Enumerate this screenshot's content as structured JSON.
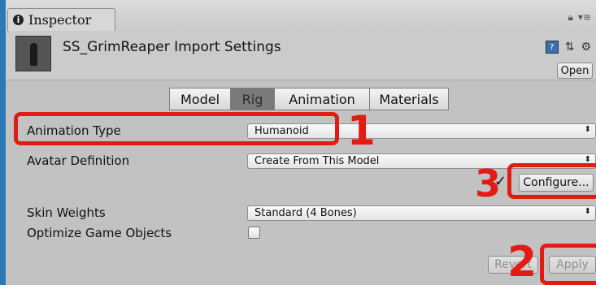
{
  "tab": {
    "title": "Inspector"
  },
  "header": {
    "title": "SS_GrimReaper Import Settings",
    "open_label": "Open"
  },
  "model_tabs": [
    {
      "label": "Model",
      "active": false
    },
    {
      "label": "Rig",
      "active": true
    },
    {
      "label": "Animation",
      "active": false
    },
    {
      "label": "Materials",
      "active": false
    }
  ],
  "fields": {
    "animation_type": {
      "label": "Animation Type",
      "value": "Humanoid"
    },
    "avatar_definition": {
      "label": "Avatar Definition",
      "value": "Create From This Model"
    },
    "configure": {
      "label": "Configure...",
      "check": "✓"
    },
    "skin_weights": {
      "label": "Skin Weights",
      "value": "Standard (4 Bones)"
    },
    "optimize": {
      "label": "Optimize Game Objects",
      "checked": false
    }
  },
  "footer": {
    "revert_label": "Revert",
    "apply_label": "Apply"
  },
  "annotations": {
    "n1": "1",
    "n2": "2",
    "n3": "3",
    "color": "#e21c14"
  },
  "icons": [
    "info-icon",
    "lock-icon",
    "menu-icon",
    "help-icon",
    "preset-icon",
    "gear-icon",
    "dropdown-arrow-icon"
  ]
}
